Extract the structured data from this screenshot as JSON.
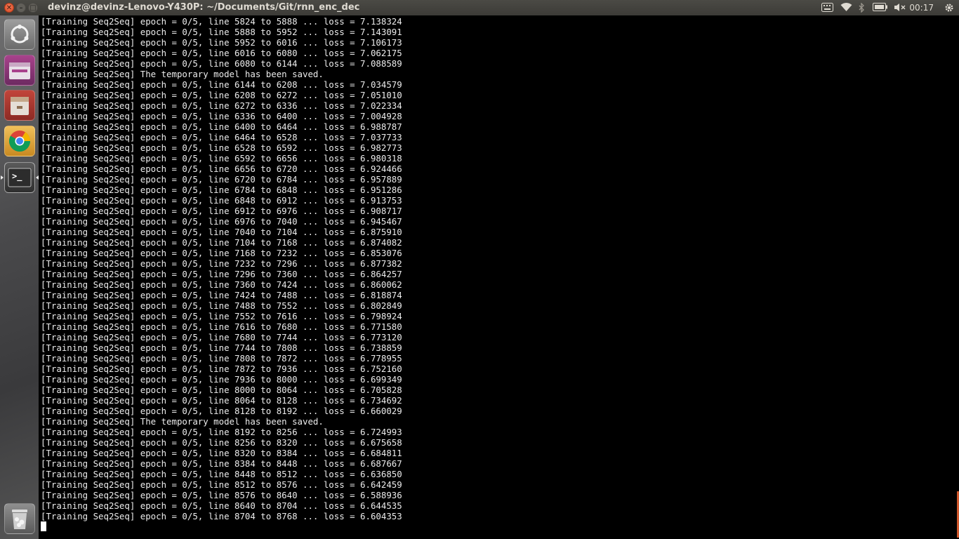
{
  "window": {
    "title": "devinz@devinz-Lenovo-Y430P: ~/Documents/Git/rnn_enc_dec",
    "close_glyph": "✕",
    "minimize_glyph": "–",
    "maximize_glyph": "□"
  },
  "panel": {
    "clock": "00:17",
    "indicators": [
      "keyboard-icon",
      "wifi-icon",
      "bluetooth-icon",
      "battery-icon",
      "volume-icon",
      "gear-icon"
    ]
  },
  "launcher": {
    "items": [
      "dash-home-icon",
      "files-icon",
      "archive-manager-icon",
      "chrome-icon",
      "terminal-icon",
      "trash-icon"
    ],
    "terminal_glyph": ">_"
  },
  "terminal": {
    "lines": [
      "[Training Seq2Seq] epoch = 0/5, line 5824 to 5888 ... loss = 7.138324",
      "[Training Seq2Seq] epoch = 0/5, line 5888 to 5952 ... loss = 7.143091",
      "[Training Seq2Seq] epoch = 0/5, line 5952 to 6016 ... loss = 7.106173",
      "[Training Seq2Seq] epoch = 0/5, line 6016 to 6080 ... loss = 7.062175",
      "[Training Seq2Seq] epoch = 0/5, line 6080 to 6144 ... loss = 7.088589",
      "[Training Seq2Seq] The temporary model has been saved.",
      "[Training Seq2Seq] epoch = 0/5, line 6144 to 6208 ... loss = 7.034579",
      "[Training Seq2Seq] epoch = 0/5, line 6208 to 6272 ... loss = 7.051010",
      "[Training Seq2Seq] epoch = 0/5, line 6272 to 6336 ... loss = 7.022334",
      "[Training Seq2Seq] epoch = 0/5, line 6336 to 6400 ... loss = 7.004928",
      "[Training Seq2Seq] epoch = 0/5, line 6400 to 6464 ... loss = 6.988787",
      "[Training Seq2Seq] epoch = 0/5, line 6464 to 6528 ... loss = 7.037733",
      "[Training Seq2Seq] epoch = 0/5, line 6528 to 6592 ... loss = 6.982773",
      "[Training Seq2Seq] epoch = 0/5, line 6592 to 6656 ... loss = 6.980318",
      "[Training Seq2Seq] epoch = 0/5, line 6656 to 6720 ... loss = 6.924466",
      "[Training Seq2Seq] epoch = 0/5, line 6720 to 6784 ... loss = 6.957889",
      "[Training Seq2Seq] epoch = 0/5, line 6784 to 6848 ... loss = 6.951286",
      "[Training Seq2Seq] epoch = 0/5, line 6848 to 6912 ... loss = 6.913753",
      "[Training Seq2Seq] epoch = 0/5, line 6912 to 6976 ... loss = 6.908717",
      "[Training Seq2Seq] epoch = 0/5, line 6976 to 7040 ... loss = 6.945467",
      "[Training Seq2Seq] epoch = 0/5, line 7040 to 7104 ... loss = 6.875910",
      "[Training Seq2Seq] epoch = 0/5, line 7104 to 7168 ... loss = 6.874082",
      "[Training Seq2Seq] epoch = 0/5, line 7168 to 7232 ... loss = 6.853076",
      "[Training Seq2Seq] epoch = 0/5, line 7232 to 7296 ... loss = 6.877382",
      "[Training Seq2Seq] epoch = 0/5, line 7296 to 7360 ... loss = 6.864257",
      "[Training Seq2Seq] epoch = 0/5, line 7360 to 7424 ... loss = 6.860062",
      "[Training Seq2Seq] epoch = 0/5, line 7424 to 7488 ... loss = 6.818874",
      "[Training Seq2Seq] epoch = 0/5, line 7488 to 7552 ... loss = 6.802849",
      "[Training Seq2Seq] epoch = 0/5, line 7552 to 7616 ... loss = 6.798924",
      "[Training Seq2Seq] epoch = 0/5, line 7616 to 7680 ... loss = 6.771580",
      "[Training Seq2Seq] epoch = 0/5, line 7680 to 7744 ... loss = 6.773120",
      "[Training Seq2Seq] epoch = 0/5, line 7744 to 7808 ... loss = 6.738859",
      "[Training Seq2Seq] epoch = 0/5, line 7808 to 7872 ... loss = 6.778955",
      "[Training Seq2Seq] epoch = 0/5, line 7872 to 7936 ... loss = 6.752160",
      "[Training Seq2Seq] epoch = 0/5, line 7936 to 8000 ... loss = 6.699349",
      "[Training Seq2Seq] epoch = 0/5, line 8000 to 8064 ... loss = 6.705828",
      "[Training Seq2Seq] epoch = 0/5, line 8064 to 8128 ... loss = 6.734692",
      "[Training Seq2Seq] epoch = 0/5, line 8128 to 8192 ... loss = 6.660029",
      "[Training Seq2Seq] The temporary model has been saved.",
      "[Training Seq2Seq] epoch = 0/5, line 8192 to 8256 ... loss = 6.724993",
      "[Training Seq2Seq] epoch = 0/5, line 8256 to 8320 ... loss = 6.675658",
      "[Training Seq2Seq] epoch = 0/5, line 8320 to 8384 ... loss = 6.684811",
      "[Training Seq2Seq] epoch = 0/5, line 8384 to 8448 ... loss = 6.687667",
      "[Training Seq2Seq] epoch = 0/5, line 8448 to 8512 ... loss = 6.636850",
      "[Training Seq2Seq] epoch = 0/5, line 8512 to 8576 ... loss = 6.642459",
      "[Training Seq2Seq] epoch = 0/5, line 8576 to 8640 ... loss = 6.588936",
      "[Training Seq2Seq] epoch = 0/5, line 8640 to 8704 ... loss = 6.644535",
      "[Training Seq2Seq] epoch = 0/5, line 8704 to 8768 ... loss = 6.604353"
    ]
  },
  "colors": {
    "terminal_bg": "#000000",
    "terminal_fg": "#ececec",
    "panel_bg": "#3c3b37",
    "accent": "#d0582d"
  }
}
